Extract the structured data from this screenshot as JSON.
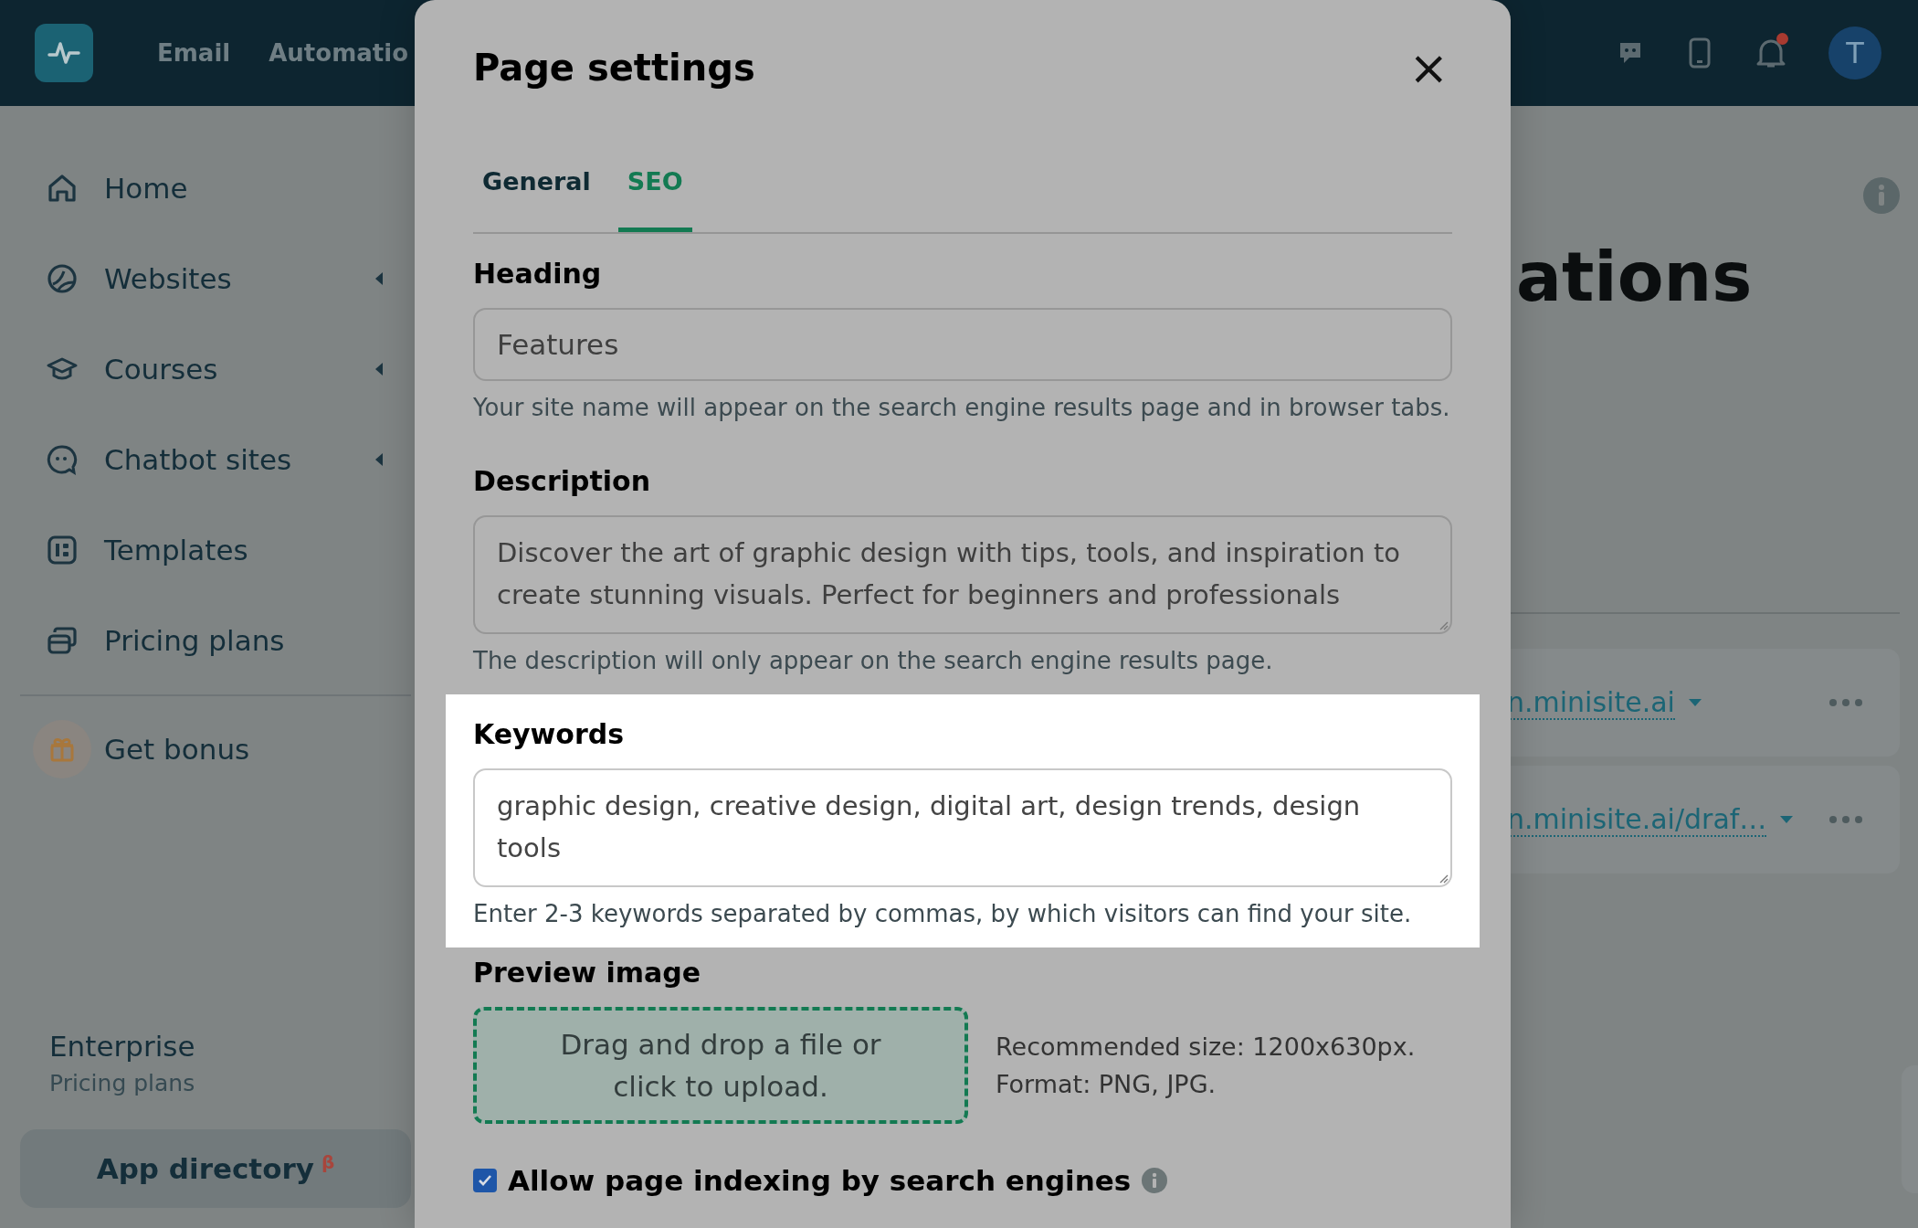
{
  "top_nav": {
    "items": [
      "Email",
      "Automatio"
    ],
    "avatar": "T",
    "notification_dot": true
  },
  "sidebar": {
    "items": [
      {
        "label": "Home",
        "has_submenu": false
      },
      {
        "label": "Websites",
        "has_submenu": true
      },
      {
        "label": "Courses",
        "has_submenu": true
      },
      {
        "label": "Chatbot sites",
        "has_submenu": true
      },
      {
        "label": "Templates",
        "has_submenu": false
      },
      {
        "label": "Pricing plans",
        "has_submenu": false
      }
    ],
    "bonus": "Get bonus",
    "plan": {
      "title": "Enterprise",
      "subtitle": "Pricing plans"
    },
    "app_directory": {
      "label": "App directory",
      "badge": "β"
    }
  },
  "background_page": {
    "heading": "ations",
    "links": [
      "n.minisite.ai",
      "n.minisite.ai/draf…"
    ]
  },
  "modal": {
    "title": "Page settings",
    "close": "×",
    "tabs": [
      {
        "label": "General",
        "selected": false
      },
      {
        "label": "SEO",
        "selected": true
      }
    ],
    "sections": [
      {
        "kind": "input",
        "label": "Heading",
        "value": "Features",
        "hint": "Your site name will appear on the search engine results page and in browser tabs.",
        "highlighted": false
      },
      {
        "kind": "textarea",
        "label": "Description",
        "value": "Discover the art of graphic design with tips, tools, and inspiration to create stunning visuals. Perfect for beginners and professionals",
        "hint": "The description will only appear on the search engine results page.",
        "highlighted": false
      },
      {
        "kind": "textarea",
        "label": "Keywords",
        "value": "graphic design, creative design, digital art, design trends, design tools",
        "hint": "Enter 2-3 keywords separated by commas, by which visitors can find your site.",
        "highlighted": true
      }
    ],
    "preview_image": {
      "label": "Preview image",
      "dropzone": "Drag and drop a file or click to upload.",
      "notes": [
        "Recommended size: 1200x630px.",
        "Format: PNG, JPG."
      ]
    },
    "indexing": {
      "label": "Allow page indexing by search engines",
      "checked": true
    }
  }
}
